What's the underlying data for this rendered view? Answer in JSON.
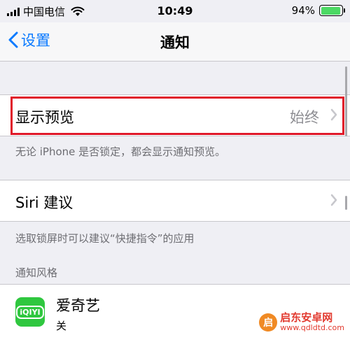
{
  "status_bar": {
    "carrier": "中国电信",
    "time": "10:49",
    "battery_percent": "94%",
    "battery_level": 0.94,
    "battery_color": "#4cd964"
  },
  "navbar": {
    "back_label": "设置",
    "title": "通知",
    "accent_color": "#0a7aff"
  },
  "preview_row": {
    "label": "显示预览",
    "value": "始终",
    "highlight_color": "#e0192a"
  },
  "preview_note": "无论 iPhone 是否锁定，都会显示通知预览。",
  "siri_row": {
    "label": "Siri 建议"
  },
  "siri_note": "选取锁屏时可以建议“快捷指令”的应用",
  "section_header": "通知风格",
  "apps": [
    {
      "name": "爱奇艺",
      "status": "关",
      "icon": "iqiyi-app-icon",
      "icon_text": "iQIYI",
      "icon_color": "#2fc73f"
    }
  ],
  "watermark": {
    "logo_text": "启",
    "title": "启东安卓网",
    "url": "www.qdldtd.com"
  },
  "icons": [
    "signal-bars-icon",
    "wifi-icon",
    "battery-icon",
    "back-chevron-icon",
    "chevron-right-icon"
  ]
}
